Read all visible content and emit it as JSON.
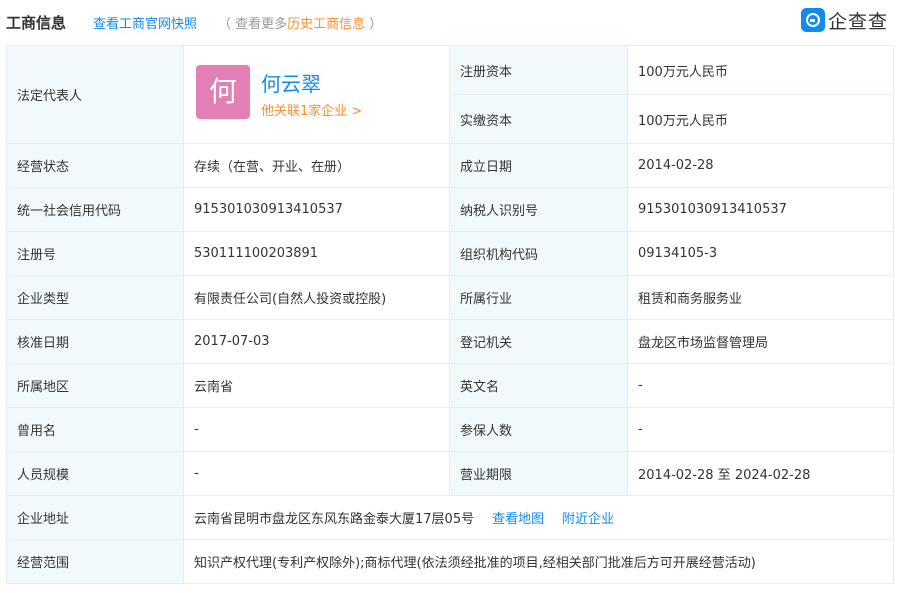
{
  "header": {
    "title": "工商信息",
    "snapshot_link": "查看工商官网快照",
    "history_prefix": "（ 查看更多",
    "history_link": "历史工商信息",
    "history_suffix": " ）",
    "logo_text": "企查查"
  },
  "legal_rep": {
    "label": "法定代表人",
    "avatar_char": "何",
    "name": "何云翠",
    "related": "他关联1家企业 >"
  },
  "registered_capital": {
    "label": "注册资本",
    "value": "100万元人民币"
  },
  "paid_capital": {
    "label": "实缴资本",
    "value": "100万元人民币"
  },
  "rows": [
    {
      "l1": "经营状态",
      "v1": "存续（在营、开业、在册）",
      "l2": "成立日期",
      "v2": "2014-02-28"
    },
    {
      "l1": "统一社会信用代码",
      "v1": "915301030913410537",
      "l2": "纳税人识别号",
      "v2": "915301030913410537"
    },
    {
      "l1": "注册号",
      "v1": "530111100203891",
      "l2": "组织机构代码",
      "v2": "09134105-3"
    },
    {
      "l1": "企业类型",
      "v1": "有限责任公司(自然人投资或控股)",
      "l2": "所属行业",
      "v2": "租赁和商务服务业"
    },
    {
      "l1": "核准日期",
      "v1": "2017-07-03",
      "l2": "登记机关",
      "v2": "盘龙区市场监督管理局"
    },
    {
      "l1": "所属地区",
      "v1": "云南省",
      "l2": "英文名",
      "v2": "-"
    },
    {
      "l1": "曾用名",
      "v1": "-",
      "l2": "参保人数",
      "v2": "-"
    },
    {
      "l1": "人员规模",
      "v1": "-",
      "l2": "营业期限",
      "v2": "2014-02-28 至 2024-02-28"
    }
  ],
  "address": {
    "label": "企业地址",
    "value": "云南省昆明市盘龙区东风东路金泰大厦17层05号",
    "map_link": "查看地图",
    "nearby_link": "附近企业"
  },
  "scope": {
    "label": "经营范围",
    "value": "知识产权代理(专利产权除外);商标代理(依法须经批准的项目,经相关部门批准后方可开展经营活动)"
  },
  "colors": {
    "link_blue": "#128bed",
    "orange": "#fd8f2e",
    "label_bg": "#f2f9fc",
    "border": "#e4eef6",
    "avatar_bg": "#e280b5"
  }
}
